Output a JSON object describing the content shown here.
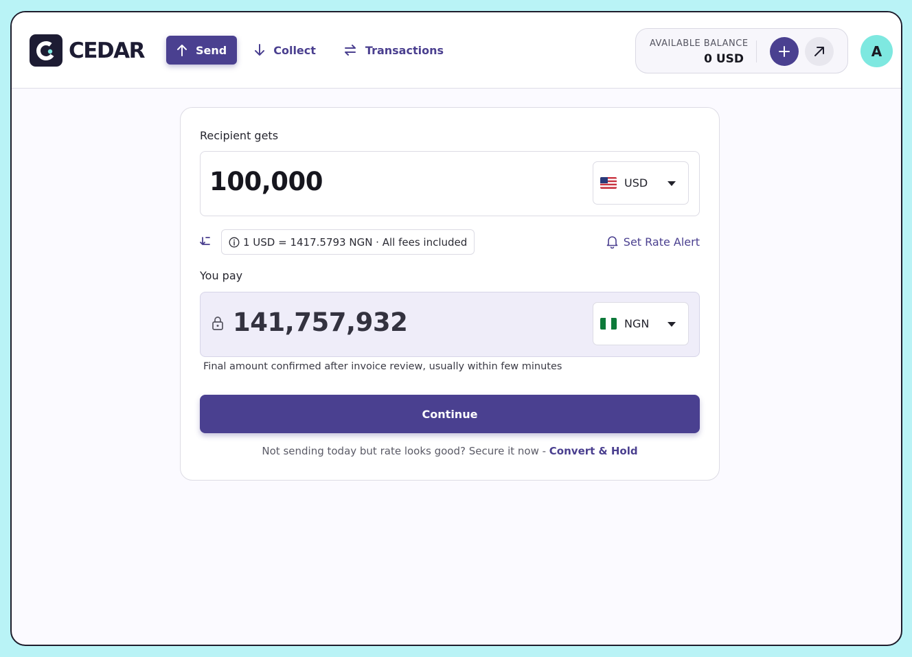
{
  "brand": {
    "name": "CEDAR"
  },
  "nav": [
    {
      "label": "Send",
      "icon": "arrow-up-icon",
      "active": true
    },
    {
      "label": "Collect",
      "icon": "arrow-down-icon",
      "active": false
    },
    {
      "label": "Transactions",
      "icon": "swap-arrows-icon",
      "active": false
    }
  ],
  "balance": {
    "label": "AVAILABLE BALANCE",
    "amount": "0 USD"
  },
  "user": {
    "avatar_initial": "A"
  },
  "transfer": {
    "recipient_label": "Recipient gets",
    "recipient_amount": "100,000",
    "recipient_currency": "USD",
    "rate_text": "1 USD = 1417.5793 NGN · All fees included",
    "rate_alert_label": "Set Rate Alert",
    "pay_label": "You pay",
    "pay_amount": "141,757,932",
    "pay_currency": "NGN",
    "note": "Final amount confirmed after invoice review, usually within few minutes",
    "continue_label": "Continue",
    "footer_text": "Not sending today but rate looks good? Secure it now - ",
    "footer_link": "Convert & Hold"
  },
  "colors": {
    "accent": "#4a4090",
    "avatar": "#7ee8e0",
    "background": "#b9f3f6"
  }
}
